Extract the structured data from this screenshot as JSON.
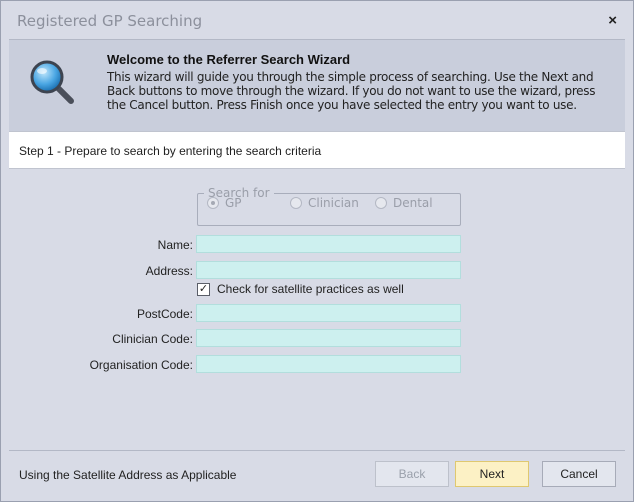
{
  "window": {
    "title": "Registered GP Searching",
    "close_glyph": "×"
  },
  "header": {
    "icon": "magnifier-icon",
    "title": "Welcome to the Referrer Search Wizard",
    "description": "This wizard will guide you through the simple process of searching. Use the Next and Back buttons to move through the wizard. If you do not want to use the wizard, press the Cancel button. Press Finish once you have selected the entry you want to use."
  },
  "step": {
    "text": "Step 1 - Prepare to search by entering the search criteria"
  },
  "search_for": {
    "legend": "Search for",
    "options": [
      {
        "label": "GP",
        "selected": true
      },
      {
        "label": "Clinician",
        "selected": false
      },
      {
        "label": "Dental",
        "selected": false
      }
    ]
  },
  "form": {
    "name_label": "Name:",
    "name_value": "",
    "address_label": "Address:",
    "address_value": "",
    "satellite_check_label": "Check for satellite practices as well",
    "satellite_checked": true,
    "postcode_label": "PostCode:",
    "postcode_value": "",
    "clinician_code_label": "Clinician Code:",
    "clinician_code_value": "",
    "organisation_code_label": "Organisation Code:",
    "organisation_code_value": ""
  },
  "footer": {
    "status_text": "Using the Satellite Address as Applicable",
    "back_label": "Back",
    "next_label": "Next",
    "cancel_label": "Cancel"
  },
  "colors": {
    "field_fill": "#cdf0ef",
    "next_fill": "#fcf1c5",
    "header_fill": "#c9cedc",
    "window_bg": "#d8dbe6"
  }
}
